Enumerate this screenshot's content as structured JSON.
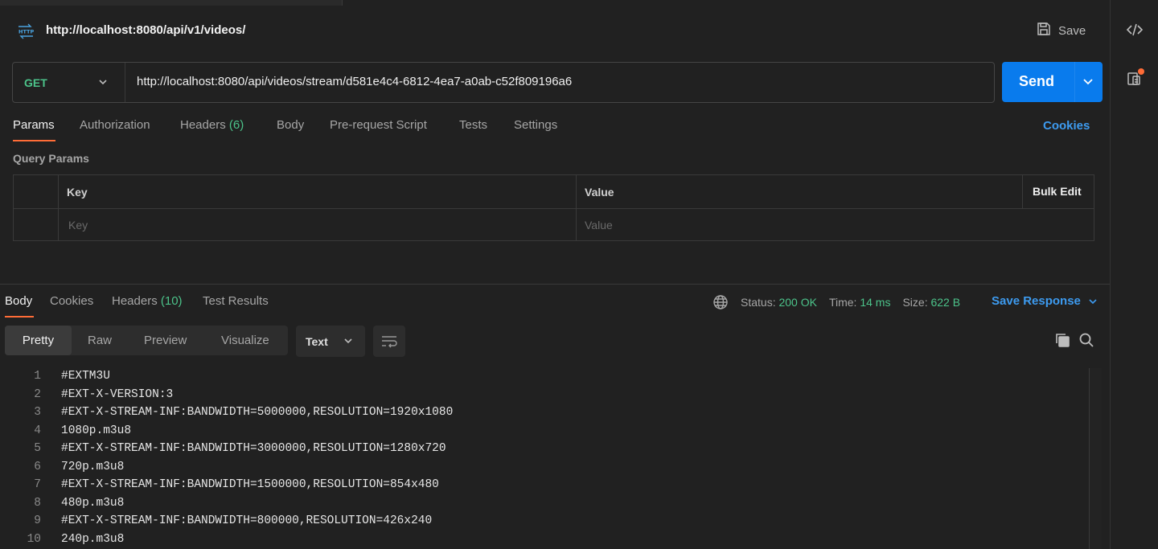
{
  "request": {
    "title": "http://localhost:8080/api/v1/videos/",
    "save_label": "Save",
    "method": "GET",
    "url": "http://localhost:8080/api/videos/stream/d581e4c4-6812-4ea7-a0ab-c52f809196a6",
    "send_label": "Send"
  },
  "req_tabs": {
    "params": "Params",
    "authorization": "Authorization",
    "headers": "Headers",
    "headers_count": "(6)",
    "body": "Body",
    "prerequest": "Pre-request Script",
    "tests": "Tests",
    "settings": "Settings",
    "cookies": "Cookies"
  },
  "query_params": {
    "title": "Query Params",
    "col_key": "Key",
    "col_value": "Value",
    "bulk_edit": "Bulk Edit",
    "key_placeholder": "Key",
    "value_placeholder": "Value"
  },
  "response": {
    "tabs": {
      "body": "Body",
      "cookies": "Cookies",
      "headers": "Headers",
      "headers_count": "(10)",
      "test_results": "Test Results"
    },
    "status_label": "Status:",
    "status_value": "200 OK",
    "time_label": "Time:",
    "time_value": "14 ms",
    "size_label": "Size:",
    "size_value": "622 B",
    "save_response": "Save Response",
    "views": {
      "pretty": "Pretty",
      "raw": "Raw",
      "preview": "Preview",
      "visualize": "Visualize"
    },
    "format": "Text",
    "lines": [
      {
        "n": "1",
        "text": "#EXTM3U"
      },
      {
        "n": "2",
        "text": "#EXT-X-VERSION:3"
      },
      {
        "n": "3",
        "text": "#EXT-X-STREAM-INF:BANDWIDTH=5000000,RESOLUTION=1920x1080"
      },
      {
        "n": "4",
        "text": "1080p.m3u8"
      },
      {
        "n": "5",
        "text": "#EXT-X-STREAM-INF:BANDWIDTH=3000000,RESOLUTION=1280x720"
      },
      {
        "n": "6",
        "text": "720p.m3u8"
      },
      {
        "n": "7",
        "text": "#EXT-X-STREAM-INF:BANDWIDTH=1500000,RESOLUTION=854x480"
      },
      {
        "n": "8",
        "text": "480p.m3u8"
      },
      {
        "n": "9",
        "text": "#EXT-X-STREAM-INF:BANDWIDTH=800000,RESOLUTION=426x240"
      },
      {
        "n": "10",
        "text": "240p.m3u8"
      }
    ]
  },
  "colors": {
    "accent_orange": "#ff6c37",
    "send_blue": "#097bed",
    "link_blue": "#3d9bf0",
    "success_green": "#4cc38a"
  },
  "icons": [
    "http-icon",
    "save-icon",
    "chevron-down-icon",
    "code-icon",
    "docs-icon",
    "globe-icon",
    "wrap-icon",
    "copy-icon",
    "search-icon"
  ]
}
